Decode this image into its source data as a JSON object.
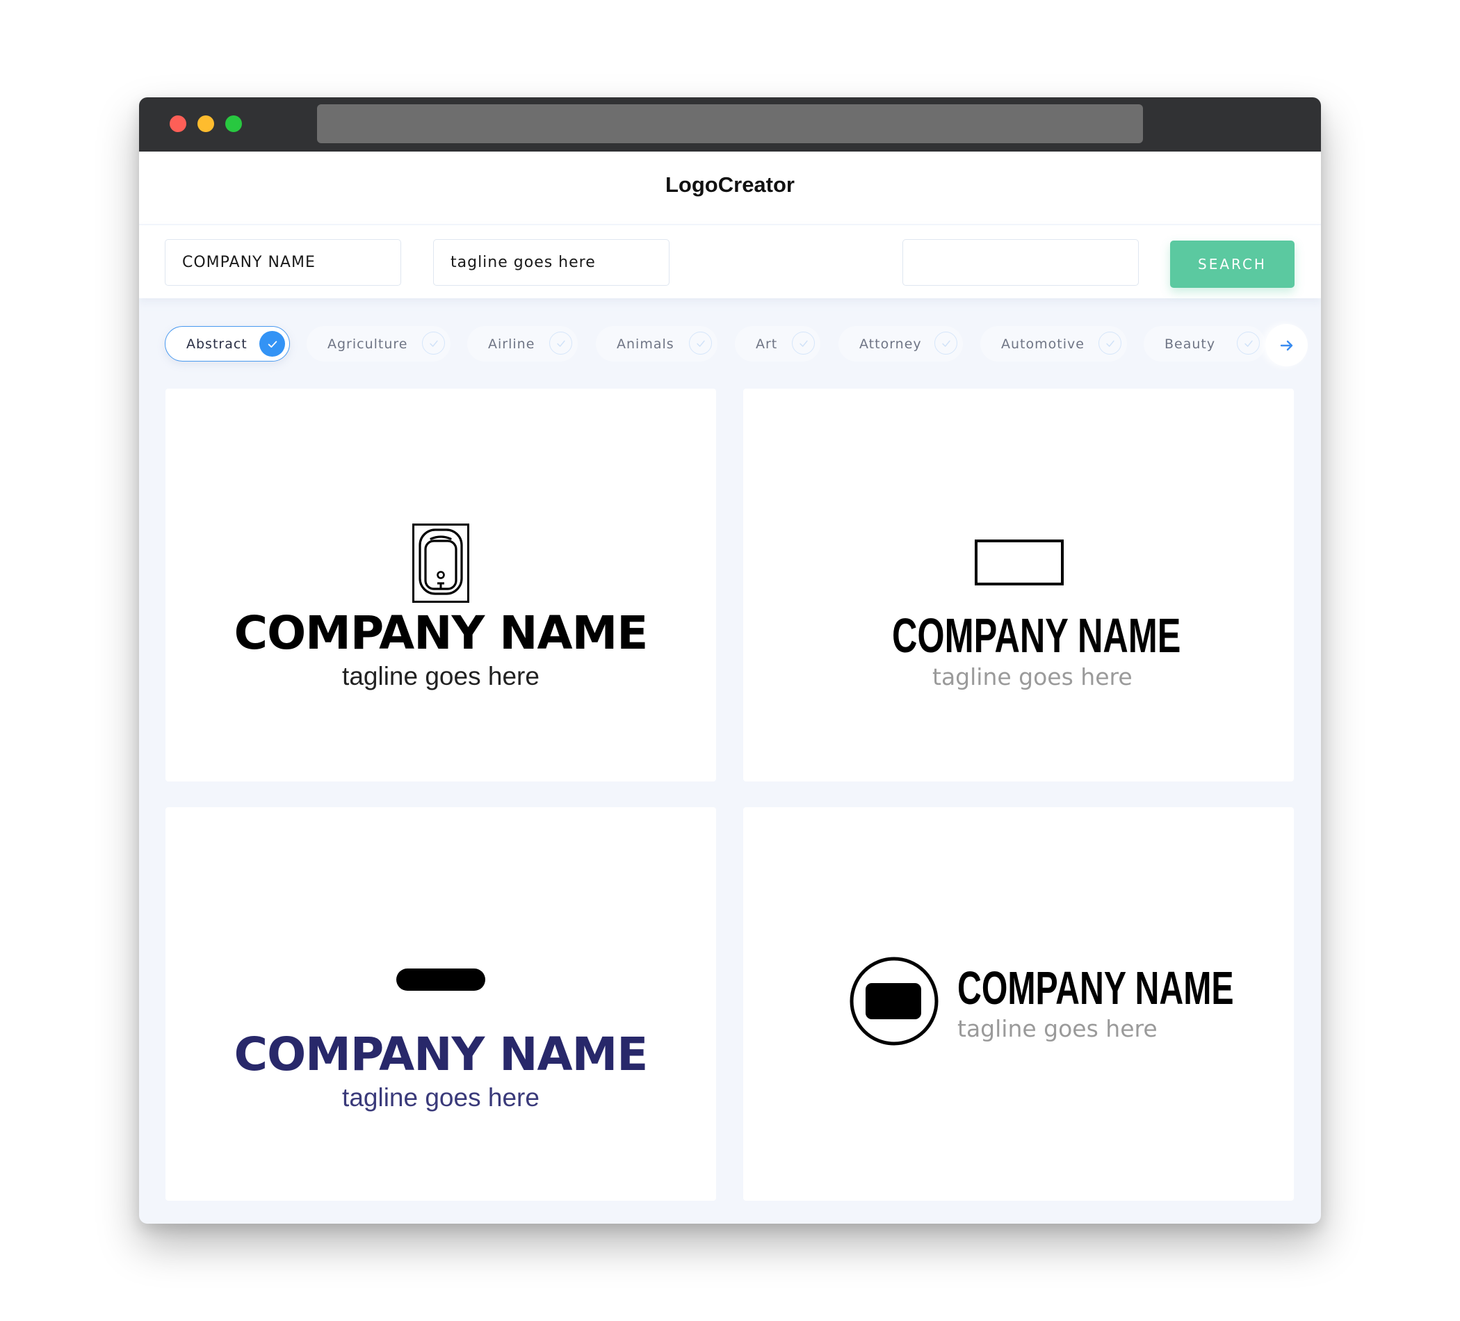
{
  "browser": {
    "traffic_lights": [
      "close",
      "minimize",
      "maximize"
    ]
  },
  "header": {
    "title": "LogoCreator"
  },
  "search": {
    "company_value": "COMPANY NAME",
    "tagline_value": "tagline goes here",
    "third_value": "",
    "button_label": "SEARCH"
  },
  "categories": [
    {
      "label": "Abstract",
      "selected": true
    },
    {
      "label": "Agriculture",
      "selected": false
    },
    {
      "label": "Airline",
      "selected": false
    },
    {
      "label": "Animals",
      "selected": false
    },
    {
      "label": "Art",
      "selected": false
    },
    {
      "label": "Attorney",
      "selected": false
    },
    {
      "label": "Automotive",
      "selected": false
    },
    {
      "label": "Beauty",
      "selected": false
    }
  ],
  "next_icon": "arrow-right-icon",
  "logos": [
    {
      "company": "COMPANY NAME",
      "tagline": "tagline goes here",
      "icon": "water-heater-icon",
      "name_color": "#000000",
      "tagline_color": "#222222"
    },
    {
      "company": "COMPANY NAME",
      "tagline": "tagline goes here",
      "icon": "rectangle-outline-icon",
      "name_color": "#000000",
      "tagline_color": "#9a9a9a"
    },
    {
      "company": "COMPANY NAME",
      "tagline": "tagline goes here",
      "icon": "pill-bar-icon",
      "name_color": "#28286a",
      "tagline_color": "#3a3a7a"
    },
    {
      "company": "COMPANY NAME",
      "tagline": "tagline goes here",
      "icon": "circle-rounded-square-icon",
      "name_color": "#000000",
      "tagline_color": "#9a9a9a"
    }
  ],
  "colors": {
    "accent_blue": "#3393f5",
    "search_green": "#5bc9a0",
    "titlebar": "#313234",
    "page_bg": "#f3f6fc"
  }
}
